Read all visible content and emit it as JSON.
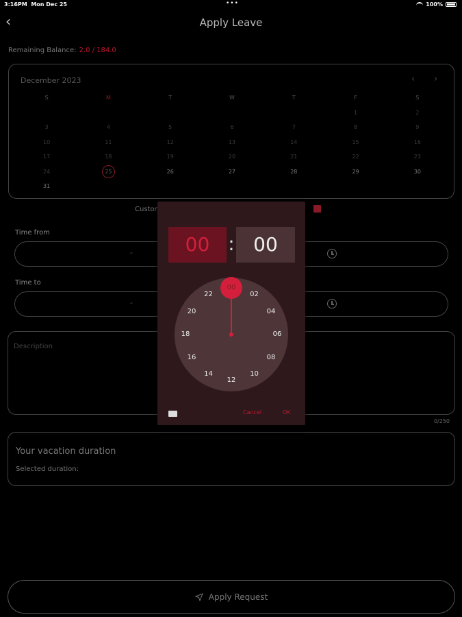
{
  "status_bar": {
    "time": "3:16PM",
    "date": "Mon Dec 25",
    "dots": "•••",
    "battery": "100%"
  },
  "header": {
    "back_glyph": "‹",
    "title": "Apply Leave"
  },
  "balance": {
    "label": "Remaining Balance:",
    "value": "2.0 / 184.0"
  },
  "calendar": {
    "month": "December 2023",
    "prev": "‹",
    "next": "›",
    "weekdays": [
      "S",
      "M",
      "T",
      "W",
      "T",
      "F",
      "S"
    ],
    "rows": [
      [
        "",
        "",
        "",
        "",
        "",
        "1",
        "2"
      ],
      [
        "3",
        "4",
        "5",
        "6",
        "7",
        "8",
        "9"
      ],
      [
        "10",
        "11",
        "12",
        "13",
        "14",
        "15",
        "16"
      ],
      [
        "17",
        "18",
        "19",
        "20",
        "21",
        "22",
        "23"
      ],
      [
        "24",
        "25",
        "26",
        "27",
        "28",
        "29",
        "30"
      ],
      [
        "31",
        "",
        "",
        "",
        "",
        "",
        ""
      ]
    ],
    "selected_day": "25"
  },
  "custom_label": "Custom",
  "time_from": {
    "label": "Time from",
    "value": "-"
  },
  "time_to": {
    "label": "Time to",
    "value": "-"
  },
  "description": {
    "placeholder": "Description",
    "counter": "0/250"
  },
  "duration": {
    "title": "Your vacation duration",
    "selected": "Selected duration:"
  },
  "apply_button": "Apply Request",
  "time_picker": {
    "hour": "00",
    "separator": ":",
    "minute": "00",
    "dial_numbers": [
      "00",
      "02",
      "04",
      "06",
      "08",
      "10",
      "12",
      "14",
      "16",
      "18",
      "20",
      "22"
    ],
    "selected": "00",
    "cancel": "Cancel",
    "ok": "OK"
  },
  "colors": {
    "accent": "#d41f3c",
    "background": "#000000",
    "dialog": "#2e181b"
  }
}
